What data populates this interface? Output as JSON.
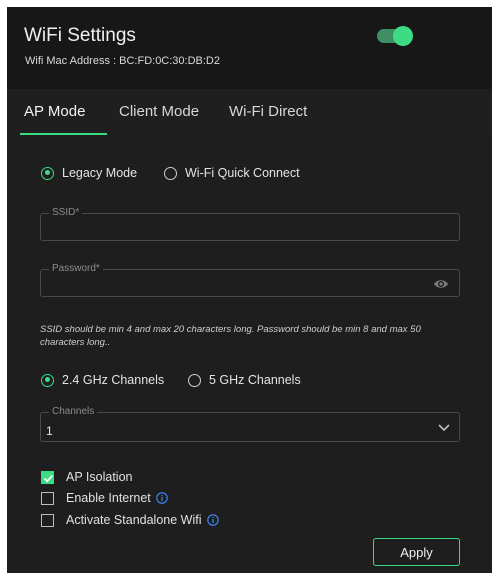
{
  "header": {
    "title": "WiFi Settings",
    "mac_label": "Wifi Mac Address : BC:FD:0C:30:DB:D2",
    "wifi_enabled": true
  },
  "tabs": [
    {
      "label": "AP Mode",
      "active": true
    },
    {
      "label": "Client Mode",
      "active": false
    },
    {
      "label": "Wi-Fi Direct",
      "active": false
    }
  ],
  "mode_options": [
    {
      "label": "Legacy Mode",
      "selected": true
    },
    {
      "label": "Wi-Fi Quick Connect",
      "selected": false
    }
  ],
  "ssid": {
    "label": "SSID*",
    "value": ""
  },
  "password": {
    "label": "Password*",
    "value": ""
  },
  "hint": "SSID should be min 4 and max 20 characters long. Password should be min 8 and max 50 characters long..",
  "band_options": [
    {
      "label": "2.4 GHz Channels",
      "selected": true
    },
    {
      "label": "5 GHz Channels",
      "selected": false
    }
  ],
  "channels": {
    "label": "Channels",
    "value": "1"
  },
  "options": [
    {
      "label": "AP Isolation",
      "checked": true,
      "info": false
    },
    {
      "label": "Enable Internet",
      "checked": false,
      "info": true
    },
    {
      "label": "Activate Standalone Wifi",
      "checked": false,
      "info": true
    }
  ],
  "apply_label": "Apply",
  "colors": {
    "accent": "#3ddc84",
    "background": "#1e1e1e",
    "header": "#171717"
  }
}
